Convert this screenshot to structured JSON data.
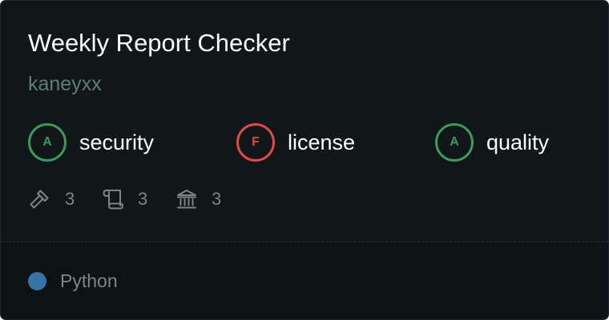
{
  "repo": {
    "title": "Weekly Report Checker",
    "owner": "kaneyxx"
  },
  "scores": [
    {
      "grade": "A",
      "label": "security",
      "status": "pass"
    },
    {
      "grade": "F",
      "label": "license",
      "status": "fail"
    },
    {
      "grade": "A",
      "label": "quality",
      "status": "pass"
    }
  ],
  "stats": [
    {
      "icon": "hammer-icon",
      "count": "3"
    },
    {
      "icon": "scroll-icon",
      "count": "3"
    },
    {
      "icon": "bank-icon",
      "count": "3"
    }
  ],
  "language": {
    "name": "Python",
    "color": "#3572a5"
  },
  "colors": {
    "pass": "#3a9a5c",
    "fail": "#e0484d",
    "card_background": "#111618",
    "footer_background": "#0d1214"
  }
}
